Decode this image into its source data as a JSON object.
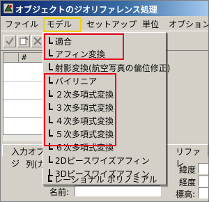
{
  "window": {
    "title": "オブジェクトのジオリファレンス処理"
  },
  "menubar": {
    "items": [
      "ファイル",
      "モデル",
      "セットアップ",
      "単位",
      "オプション"
    ]
  },
  "model_menu": {
    "items": [
      "適合",
      "アフィン変換",
      "射影変換(航空写真の偏位修正)",
      "バイリニア",
      "２次多項式変換",
      "３次多項式変換",
      "４次多項式変換",
      "５次多項式変換",
      "６次多項式変換",
      "2Dピースワイズアフィン",
      "3Dピースワイズアフィン",
      "レーショナル ポリノミアル"
    ]
  },
  "grid": {
    "col_hash": "#"
  },
  "lower_panel": {
    "tab_left": "入力オブジ",
    "tab_right": "リファレ",
    "label_col": "列(カ",
    "label_name": "名前:",
    "label_lat": "緯度",
    "label_lon": "経度",
    "label_elev": "標高:"
  }
}
